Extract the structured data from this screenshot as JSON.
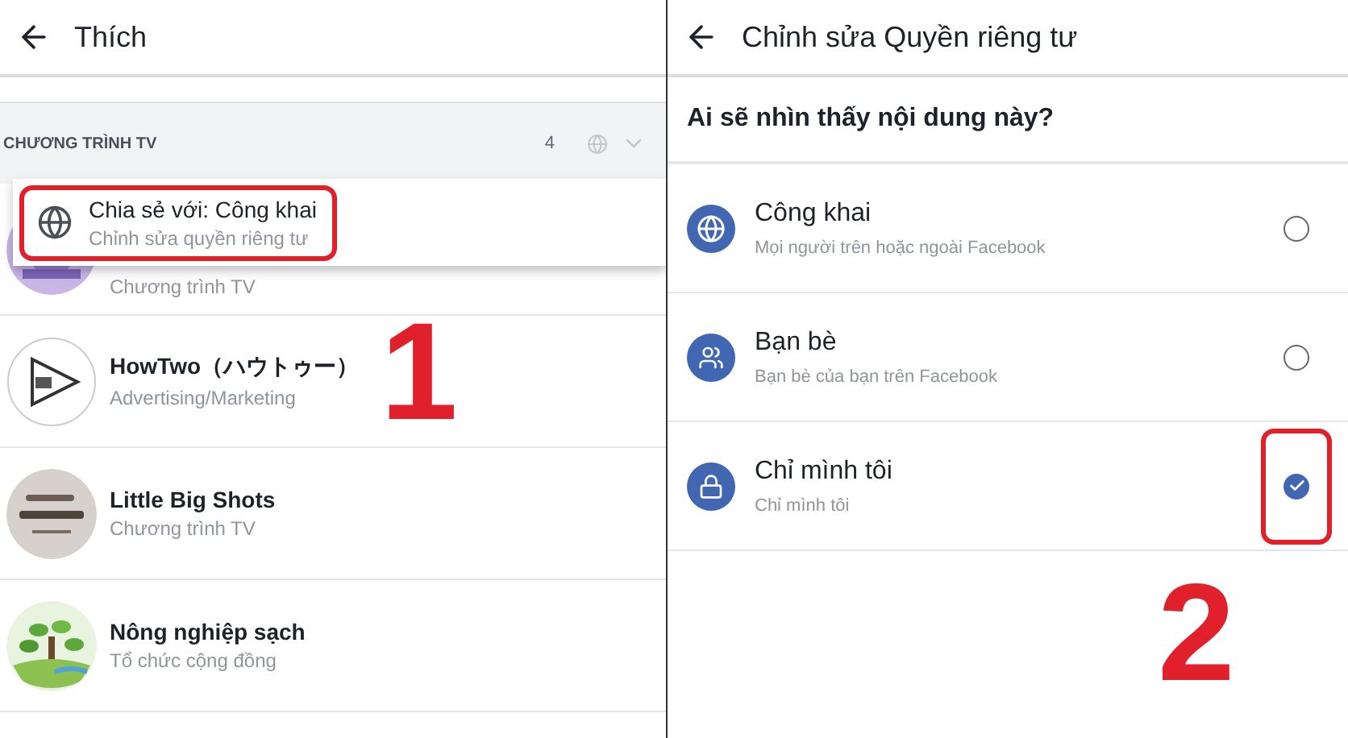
{
  "left_screen": {
    "title": "Thích",
    "section": {
      "title": "CHƯƠNG TRÌNH TV",
      "count": "4"
    },
    "popup": {
      "title": "Chia sẻ với: Công khai",
      "subtitle": "Chỉnh sửa quyền riêng tư",
      "highlighted": true
    },
    "pages": [
      {
        "subtitle": "Chương trình TV"
      },
      {
        "name": "HowTwo（ハウトゥー）",
        "subtitle": "Advertising/Marketing"
      },
      {
        "name": "Little Big Shots",
        "subtitle": "Chương trình TV"
      },
      {
        "name": "Nông nghiệp sạch",
        "subtitle": "Tổ chức cộng đồng"
      }
    ],
    "annotation": "1"
  },
  "right_screen": {
    "title": "Chỉnh sửa Quyền riêng tư",
    "question": "Ai sẽ nhìn thấy nội dung này?",
    "options": [
      {
        "kind": "globe",
        "label": "Công khai",
        "description": "Mọi người trên hoặc ngoài Facebook",
        "selected": false,
        "highlighted": false
      },
      {
        "kind": "friends",
        "label": "Bạn bè",
        "description": "Bạn bè của bạn trên Facebook",
        "selected": false,
        "highlighted": false
      },
      {
        "kind": "lock",
        "label": "Chỉ mình tôi",
        "description": "Chỉ mình tôi",
        "selected": true,
        "highlighted": true
      }
    ],
    "annotation": "2"
  }
}
